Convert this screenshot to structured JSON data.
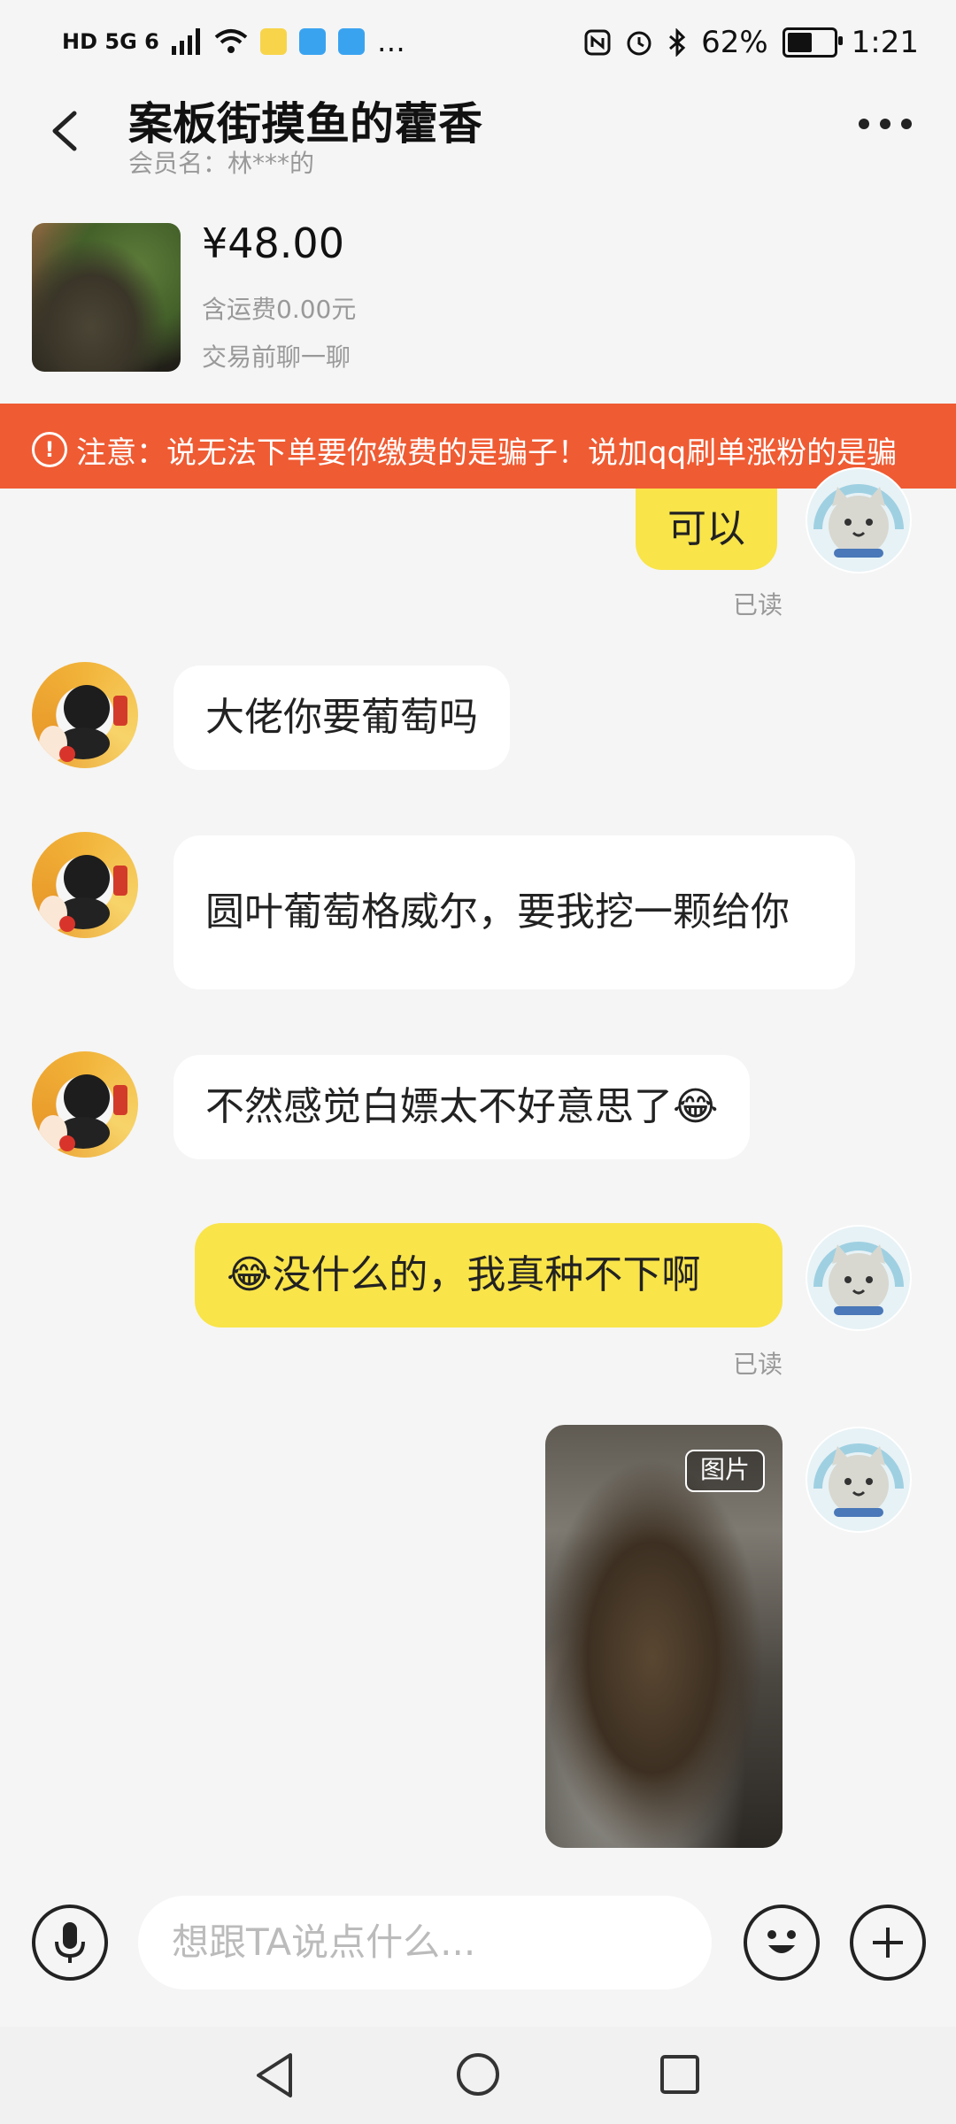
{
  "status_bar": {
    "left_text": "HD 5G 6",
    "battery": "62%",
    "battery_level": 0.62,
    "time": "1:21"
  },
  "header": {
    "title": "案板街摸鱼的藿香",
    "member_label": "会员名：林***的"
  },
  "product": {
    "price": "¥48.00",
    "shipping": "含运费0.00元",
    "chat_hint": "交易前聊一聊"
  },
  "warning_banner": {
    "text": "注意：说无法下单要你缴费的是骗子！说加qq刷单涨粉的是骗"
  },
  "messages": [
    {
      "side": "out",
      "text": "可以",
      "read": "已读"
    },
    {
      "side": "in",
      "text": "大佬你要葡萄吗"
    },
    {
      "side": "in",
      "text": "圆叶葡萄格威尔，要我挖一颗给你"
    },
    {
      "side": "in",
      "text": "不然感觉白嫖太不好意思了😂"
    },
    {
      "side": "out",
      "text": "😂没什么的，我真种不下啊",
      "read": "已读"
    },
    {
      "side": "out",
      "type": "image",
      "tag": "图片"
    }
  ],
  "input_bar": {
    "placeholder": "想跟TA说点什么..."
  },
  "colors": {
    "banner": "#ef5b33",
    "bubble_out": "#f9e44a",
    "bubble_in": "#ffffff"
  }
}
